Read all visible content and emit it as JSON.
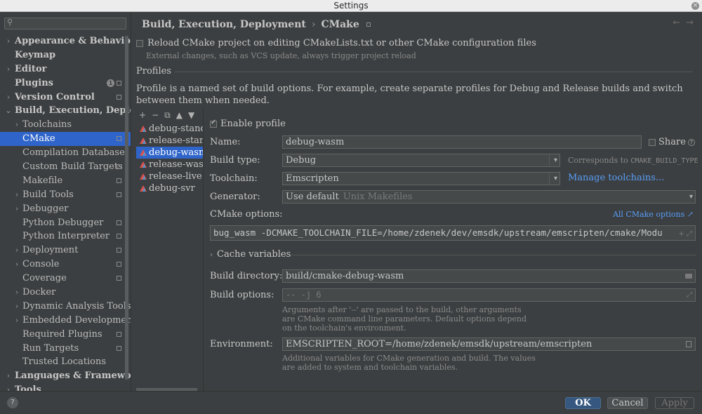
{
  "window": {
    "title": "Settings"
  },
  "sidebar": {
    "search_placeholder": "",
    "items": [
      {
        "label": "Appearance & Behavior",
        "level": 0,
        "expandable": true
      },
      {
        "label": "Keymap",
        "level": 0,
        "expandable": false
      },
      {
        "label": "Editor",
        "level": 0,
        "expandable": true
      },
      {
        "label": "Plugins",
        "level": 0,
        "expandable": false,
        "badge": "1",
        "scope": true
      },
      {
        "label": "Version Control",
        "level": 0,
        "expandable": true,
        "scope": true
      },
      {
        "label": "Build, Execution, Deployment",
        "level": 0,
        "expandable": true,
        "expanded": true
      },
      {
        "label": "Toolchains",
        "level": 1,
        "expandable": true
      },
      {
        "label": "CMake",
        "level": 1,
        "expandable": false,
        "selected": true,
        "scope": true
      },
      {
        "label": "Compilation Database",
        "level": 1,
        "expandable": false
      },
      {
        "label": "Custom Build Targets",
        "level": 1,
        "expandable": false,
        "scope": true
      },
      {
        "label": "Makefile",
        "level": 1,
        "expandable": false,
        "scope": true
      },
      {
        "label": "Build Tools",
        "level": 1,
        "expandable": true,
        "scope": true
      },
      {
        "label": "Debugger",
        "level": 1,
        "expandable": true
      },
      {
        "label": "Python Debugger",
        "level": 1,
        "expandable": false,
        "scope": true
      },
      {
        "label": "Python Interpreter",
        "level": 1,
        "expandable": false,
        "scope": true
      },
      {
        "label": "Deployment",
        "level": 1,
        "expandable": true,
        "scope": true
      },
      {
        "label": "Console",
        "level": 1,
        "expandable": true,
        "scope": true
      },
      {
        "label": "Coverage",
        "level": 1,
        "expandable": false,
        "scope": true
      },
      {
        "label": "Docker",
        "level": 1,
        "expandable": true
      },
      {
        "label": "Dynamic Analysis Tools",
        "level": 1,
        "expandable": true
      },
      {
        "label": "Embedded Development",
        "level": 1,
        "expandable": true
      },
      {
        "label": "Required Plugins",
        "level": 1,
        "expandable": false,
        "scope": true
      },
      {
        "label": "Run Targets",
        "level": 1,
        "expandable": false,
        "scope": true
      },
      {
        "label": "Trusted Locations",
        "level": 1,
        "expandable": false
      },
      {
        "label": "Languages & Frameworks",
        "level": 0,
        "expandable": true
      },
      {
        "label": "Tools",
        "level": 0,
        "expandable": true
      }
    ]
  },
  "header": {
    "crumb1": "Build, Execution, Deployment",
    "separator": "›",
    "crumb2": "CMake",
    "back_arrow": "←",
    "forward_arrow": "→"
  },
  "reload": {
    "label": "Reload CMake project on editing CMakeLists.txt or other CMake configuration files",
    "hint": "External changes, such as VCS update, always trigger project reload",
    "checked": false
  },
  "profiles": {
    "title": "Profiles",
    "description": "Profile is a named set of build options. For example, create separate profiles for Debug and Release builds and switch between them when needed.",
    "toolbar": {
      "add": "+",
      "remove": "−",
      "copy": "⧉",
      "up": "▲",
      "down": "▼"
    },
    "items": [
      {
        "label": "debug-standalone"
      },
      {
        "label": "release-standalone"
      },
      {
        "label": "debug-wasm",
        "selected": true
      },
      {
        "label": "release-wasm"
      },
      {
        "label": "release-live"
      },
      {
        "label": "debug-svr"
      }
    ]
  },
  "form": {
    "enable_label": "Enable profile",
    "enable_checked": true,
    "name_label": "Name:",
    "name_value": "debug-wasm",
    "share_label": "Share",
    "share_help": "?",
    "build_type_label": "Build type:",
    "build_type_value": "Debug",
    "corresponds_prefix": "Corresponds to ",
    "corresponds_code": "CMAKE_BUILD_TYPE",
    "toolchain_label": "Toolchain:",
    "toolchain_value": "Emscripten",
    "manage_toolchains": "Manage toolchains...",
    "generator_label": "Generator:",
    "generator_value": "Use default",
    "generator_muted": "Unix Makefiles",
    "cmake_options_label": "CMake options:",
    "all_cmake_options": "All CMake options ↗",
    "cmake_options_value": "bug_wasm -DCMAKE_TOOLCHAIN_FILE=/home/zdenek/dev/emsdk/upstream/emscripten/cmake/Modu",
    "cmake_options_icons": "+ ⤢",
    "cache_variables": "Cache variables",
    "build_dir_label": "Build directory:",
    "build_dir_value": "build/cmake-debug-wasm",
    "build_options_label": "Build options:",
    "build_options_placeholder": "-- -j 6",
    "build_options_hint": "Arguments after '--' are passed to the build, other arguments are CMake command line parameters. Default options depend on the toolchain's environment.",
    "environment_label": "Environment:",
    "environment_value": "EMSCRIPTEN_ROOT=/home/zdenek/emsdk/upstream/emscripten",
    "environment_hint": "Additional variables for CMake generation and build. The values are added to system and toolchain variables."
  },
  "footer": {
    "help": "?",
    "ok": "OK",
    "cancel": "Cancel",
    "apply": "Apply"
  },
  "colors": {
    "background": "#3c3f41",
    "selection": "#2f65ca",
    "link": "#589df6",
    "ok_button": "#365880"
  }
}
